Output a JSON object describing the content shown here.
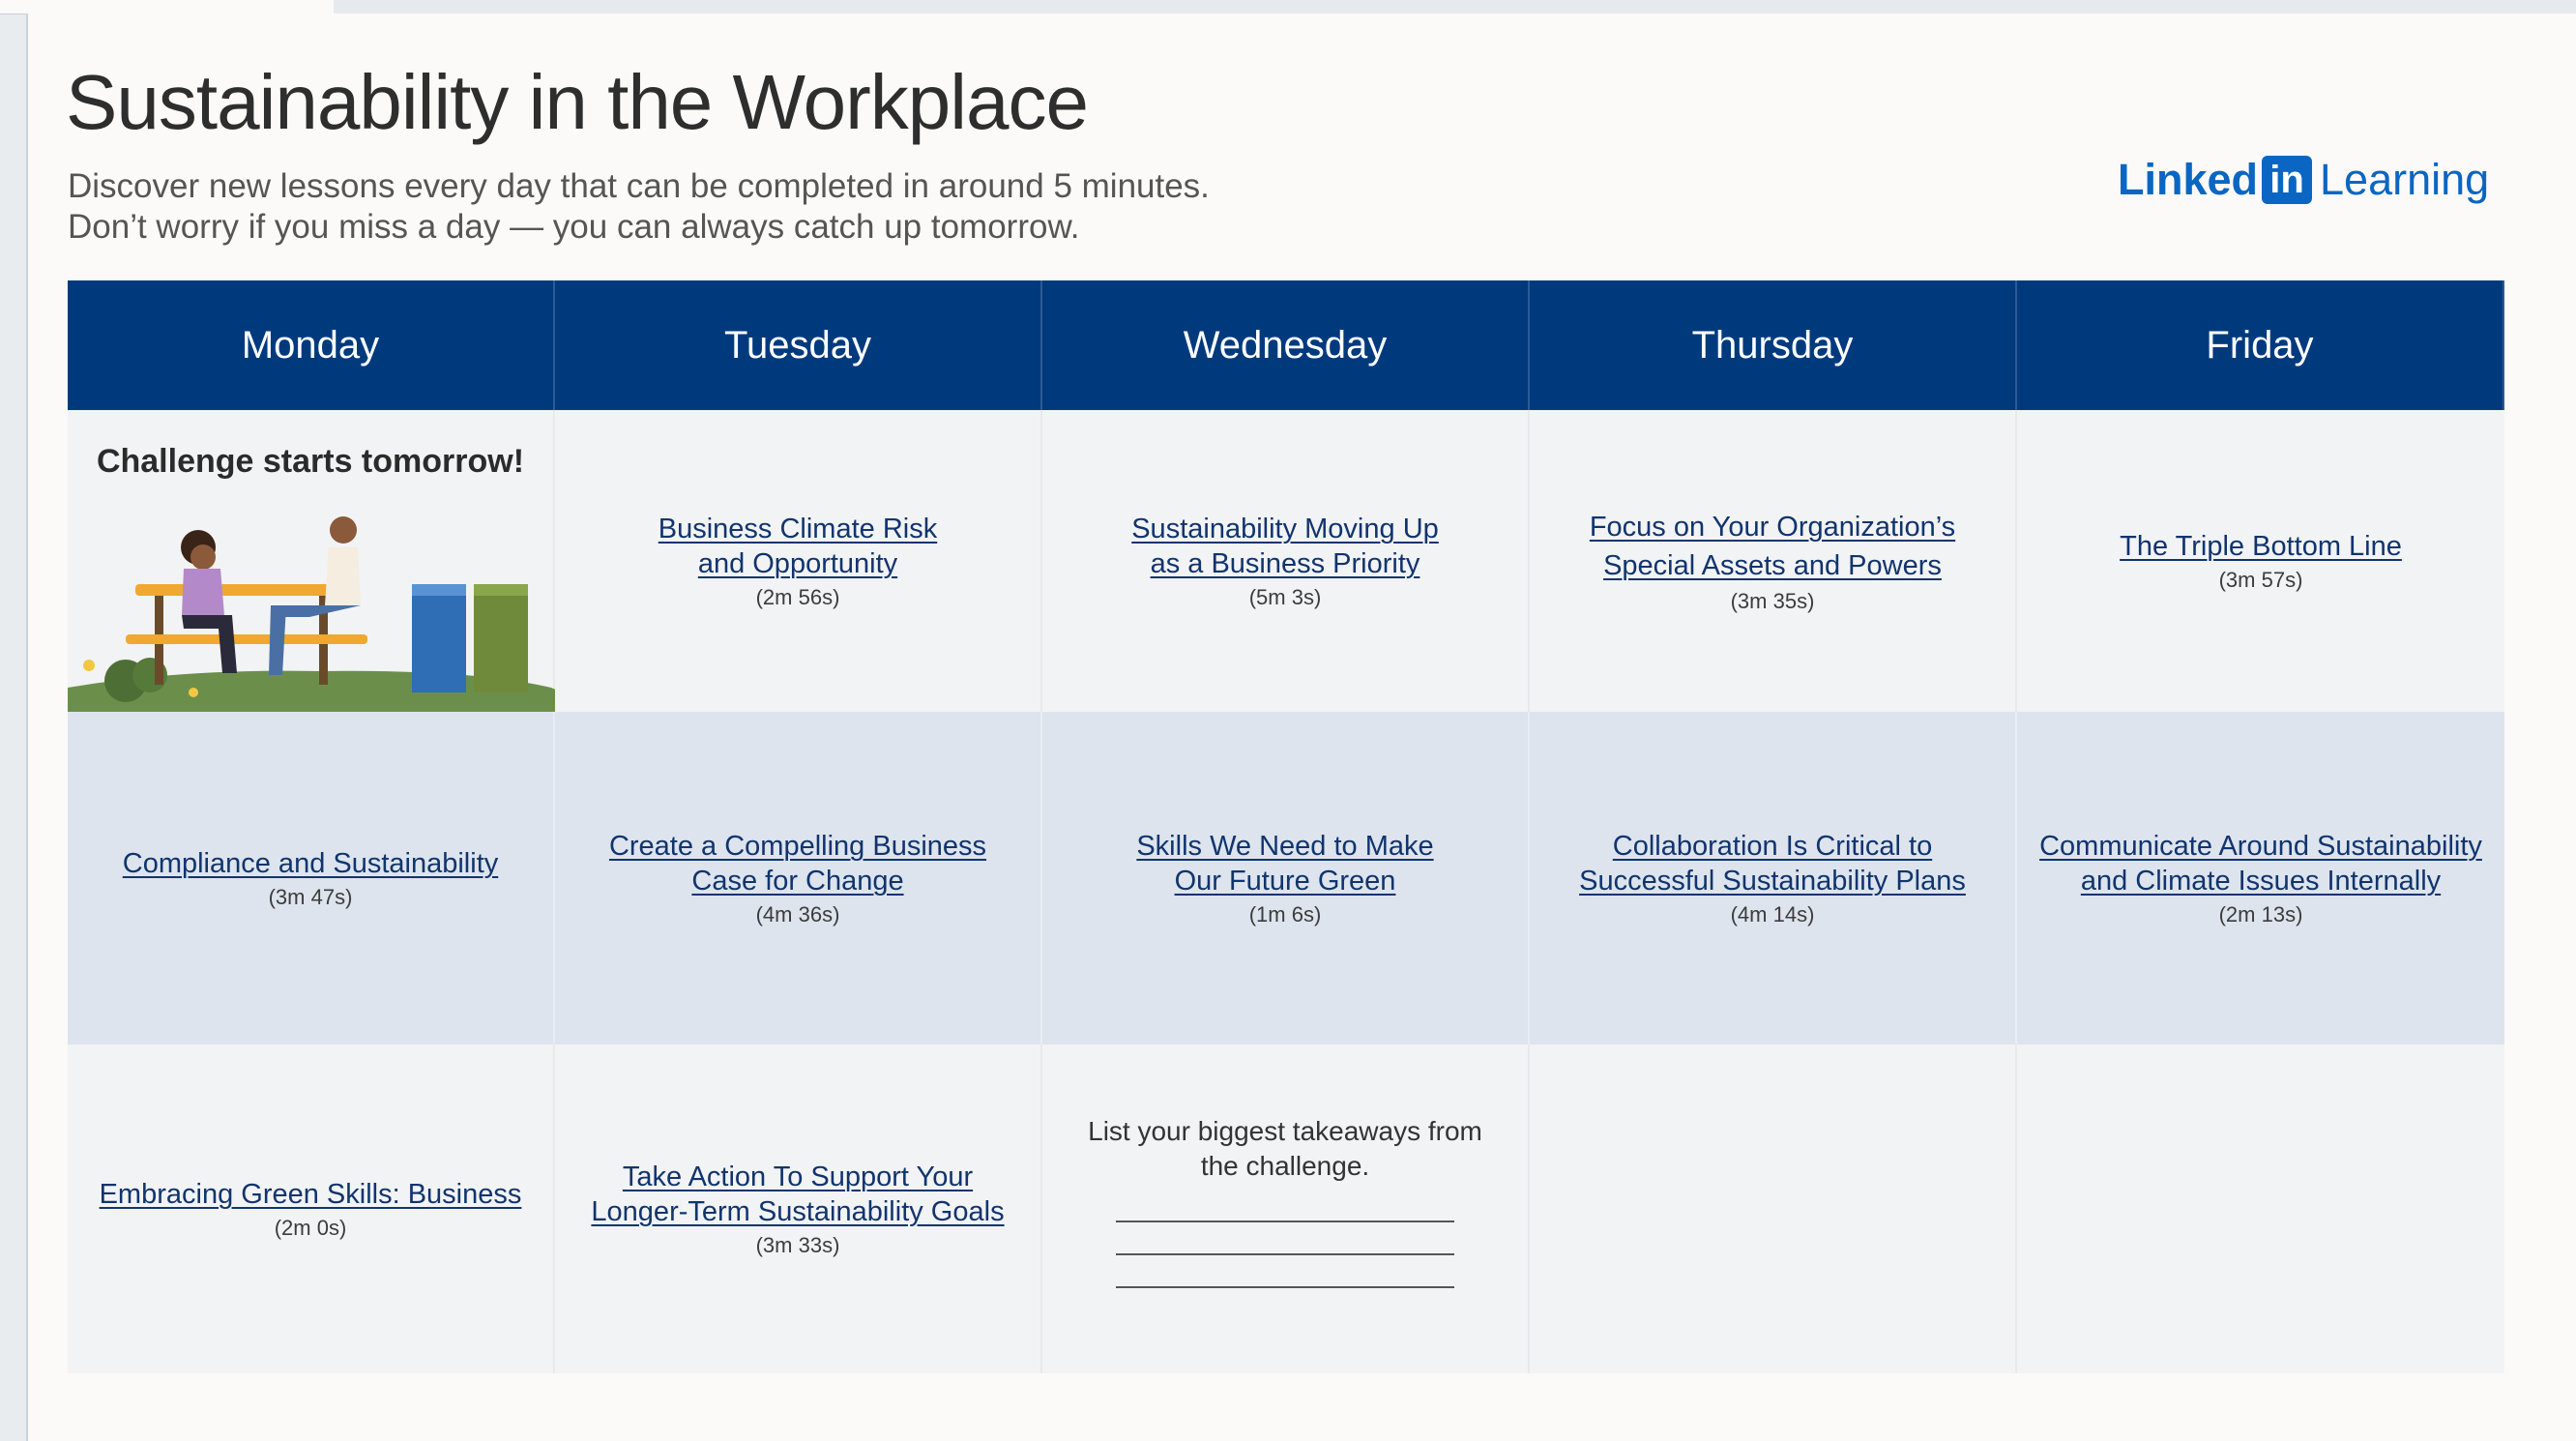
{
  "page": {
    "title": "Sustainability in the Workplace",
    "subtitle_line1": "Discover new lessons every day that can be completed in around 5 minutes.",
    "subtitle_line2": "Don’t worry if you miss a day — you can always catch up tomorrow."
  },
  "logo": {
    "linked": "Linked",
    "in": "in",
    "learning": "Learning"
  },
  "days": [
    "Monday",
    "Tuesday",
    "Wednesday",
    "Thursday",
    "Friday"
  ],
  "week1": {
    "monday": "Challenge starts tomorrow!",
    "tuesday": {
      "line1": "Business Climate Risk",
      "line2": "and Opportunity",
      "duration": "(2m 56s)"
    },
    "wednesday": {
      "line1": "Sustainability Moving Up",
      "line2": "as a Business Priority",
      "duration": "(5m 3s)"
    },
    "thursday": {
      "line1": "Focus on Your Organization’s",
      "line2": "Special Assets and Powers",
      "duration": "(3m 35s)"
    },
    "friday": {
      "line1": "The Triple Bottom Line",
      "duration": "(3m 57s)"
    }
  },
  "week2": {
    "monday": {
      "line1": "Compliance and Sustainability",
      "duration": "(3m 47s)"
    },
    "tuesday": {
      "line1": "Create a Compelling Business",
      "line2": "Case for Change",
      "duration": "(4m 36s)"
    },
    "wednesday": {
      "line1": "Skills We Need to Make",
      "line2": "Our Future Green",
      "duration": "(1m 6s)"
    },
    "thursday": {
      "line1": "Collaboration Is Critical to",
      "line2": "Successful Sustainability Plans",
      "duration": "(4m 14s)"
    },
    "friday": {
      "line1": "Communicate Around Sustainability",
      "line2": "and Climate Issues Internally",
      "duration": "(2m 13s)"
    }
  },
  "week3": {
    "monday": {
      "line1": "Embracing Green Skills: Business",
      "duration": "(2m 0s)"
    },
    "tuesday": {
      "line1": "Take Action To Support Your",
      "line2": "Longer-Term Sustainability Goals",
      "duration": "(3m 33s)"
    },
    "wednesday": {
      "line1": "List your biggest takeaways from",
      "line2": "the challenge."
    }
  },
  "colors": {
    "header_blue": "#003a7d",
    "link_blue": "#11346e",
    "brand_blue": "#0a66c2",
    "row_alt": "#dde4ed"
  },
  "icons": [
    "picnic-illustration",
    "recycling-bins-icon"
  ]
}
